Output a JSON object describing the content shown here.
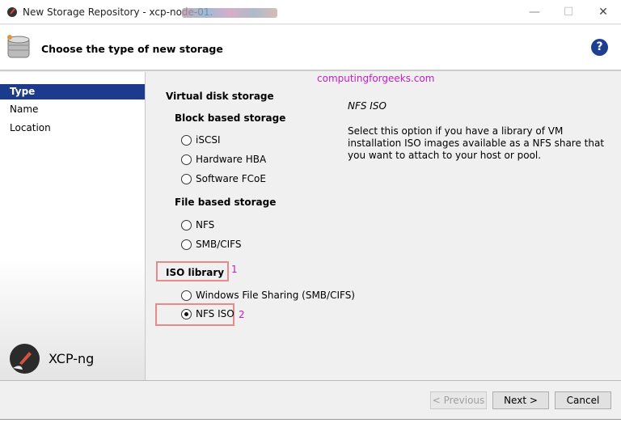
{
  "window": {
    "title": "New Storage Repository - xcp-node-01.",
    "minimize": "—",
    "maximize": "☐",
    "close": "✕"
  },
  "header": {
    "title": "Choose the type of new storage",
    "help": "?"
  },
  "sidebar": {
    "items": [
      {
        "label": "Type",
        "selected": true
      },
      {
        "label": "Name"
      },
      {
        "label": "Location"
      }
    ],
    "brand": "XCP-ng"
  },
  "watermark": "computingforgeeks.com",
  "options": {
    "virtual_disk": "Virtual disk storage",
    "block": "Block based storage",
    "block_items": [
      "iSCSI",
      "Hardware HBA",
      "Software FCoE"
    ],
    "file": "File based storage",
    "file_items": [
      "NFS",
      "SMB/CIFS"
    ],
    "iso": "ISO library",
    "iso_items": [
      "Windows File Sharing (SMB/CIFS)",
      "NFS ISO"
    ],
    "selected": "NFS ISO"
  },
  "annotations": [
    "1",
    "2"
  ],
  "description": {
    "title": "NFS ISO",
    "text": "Select this option if you have a library of VM installation ISO images available as a NFS share that you want to attach to your host or pool."
  },
  "buttons": {
    "previous": "< Previous",
    "next": "Next >",
    "cancel": "Cancel"
  }
}
